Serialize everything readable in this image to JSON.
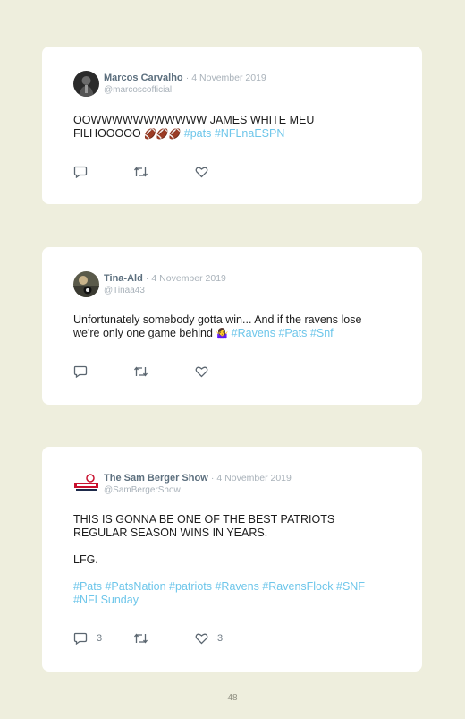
{
  "tweets": [
    {
      "name": "Marcos Carvalho",
      "separator": "·",
      "date": "4 November 2019",
      "handle": "@marcoscofficial",
      "text_lines": [
        "OOWWWWWWWWWWW JAMES WHITE MEU",
        "FILHOOOOO"
      ],
      "emoji": "🏈🏈🏈",
      "hashtags": [
        "#pats",
        "#NFLnaESPN"
      ],
      "replies": "",
      "retweets": "",
      "likes": ""
    },
    {
      "name": "Tina-Ald",
      "separator": "·",
      "date": "4 November 2019",
      "handle": "@Tinaa43",
      "text_lines": [
        "Unfortunately somebody gotta win... And if the ravens lose",
        "we're only one game behind"
      ],
      "emoji": "🤷‍♀️",
      "hashtags": [
        "#Ravens",
        "#Pats",
        "#Snf"
      ],
      "replies": "",
      "retweets": "",
      "likes": ""
    },
    {
      "name": "The Sam Berger Show",
      "separator": "·",
      "date": "4 November 2019",
      "handle": "@SamBergerShow",
      "text_lines": [
        "THIS IS GONNA BE ONE OF THE BEST PATRIOTS",
        "REGULAR SEASON WINS IN YEARS."
      ],
      "second_paragraph": "LFG.",
      "hashtags": [
        "#Pats",
        "#PatsNation",
        "#patriots",
        "#Ravens",
        "#RavensFlock",
        "#SNF",
        "#NFLSunday"
      ],
      "replies": "3",
      "retweets": "",
      "likes": "3"
    }
  ],
  "page_number": "48",
  "colors": {
    "background": "#eeeedd",
    "card": "#ffffff",
    "hashtag": "#6ec6ea",
    "name": "#5c6f7e",
    "meta": "#a9b2ba"
  },
  "icons": [
    "reply-icon",
    "retweet-icon",
    "like-icon"
  ]
}
